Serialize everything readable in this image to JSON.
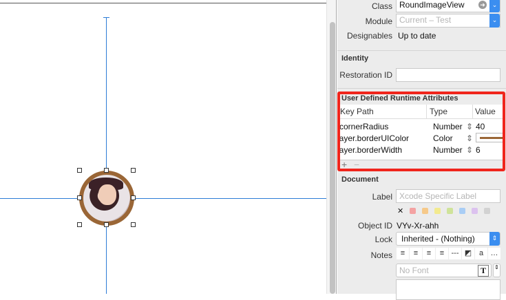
{
  "inspector": {
    "class_label": "Class",
    "class_value": "RoundImageView",
    "module_label": "Module",
    "module_placeholder": "Current – Test",
    "designables_label": "Designables",
    "designables_value": "Up to date",
    "identity_header": "Identity",
    "restoration_label": "Restoration ID",
    "restoration_value": "",
    "udra_header": "User Defined Runtime Attributes",
    "columns": [
      "Key Path",
      "Type",
      "Value"
    ],
    "rows": [
      {
        "key": "cornerRadius",
        "type": "Number",
        "value": "40"
      },
      {
        "key": "layer.borderUIColor",
        "type": "Color",
        "value": ""
      },
      {
        "key": "layer.borderWidth",
        "type": "Number",
        "value": "6"
      }
    ],
    "add": "+",
    "remove": "−",
    "document_header": "Document",
    "label_label": "Label",
    "label_placeholder": "Xcode Specific Label",
    "clear_tag": "✕",
    "tag_colors": [
      "#f4a3a3",
      "#f6c98a",
      "#f3ea8f",
      "#cfe39a",
      "#a9cdf5",
      "#dcc2ef",
      "#d2d2d2"
    ],
    "object_id_label": "Object ID",
    "object_id": "VYv-Xr-ahh",
    "lock_label": "Lock",
    "lock_value": "Inherited - (Nothing)",
    "notes_label": "Notes",
    "font_placeholder": "No Font",
    "font_icon": "T",
    "border_color": "#9a6636"
  }
}
